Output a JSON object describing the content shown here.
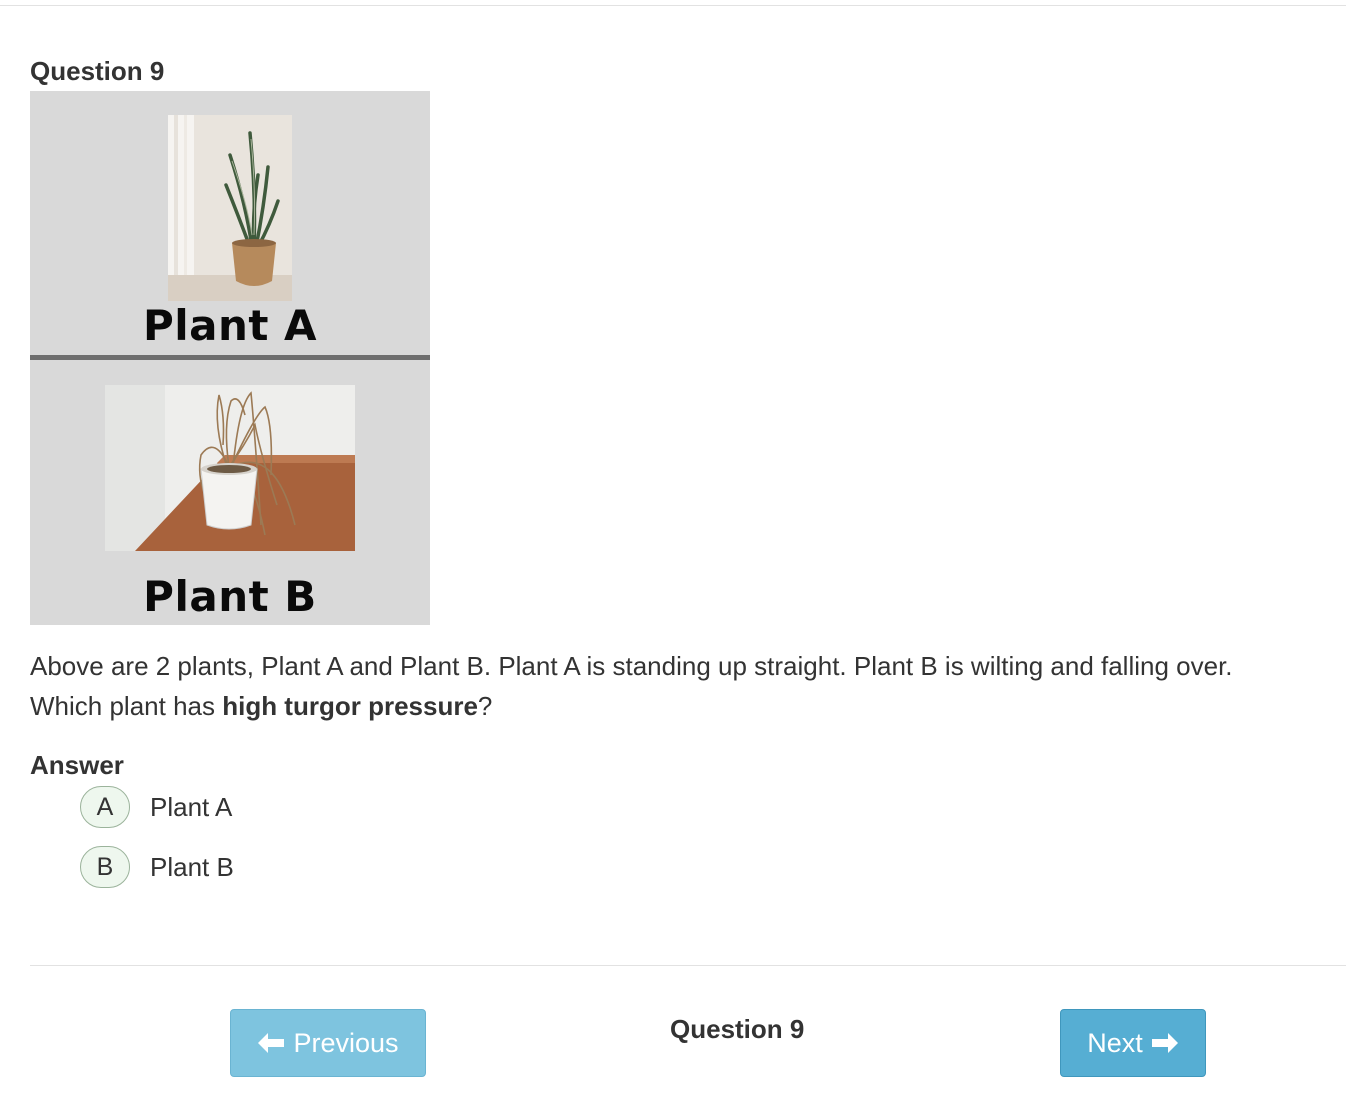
{
  "question": {
    "title": "Question 9",
    "figure": {
      "plant_a_label": "Plant A",
      "plant_b_label": "Plant B"
    },
    "prompt_line1": "Above are 2 plants, Plant A and Plant B. Plant A is standing up straight. Plant B is wilting and falling over.",
    "prompt_line2_before": "Which plant has ",
    "prompt_line2_bold": "high turgor pressure",
    "prompt_line2_after": "?"
  },
  "answer": {
    "heading": "Answer",
    "options": [
      {
        "letter": "A",
        "text": "Plant A"
      },
      {
        "letter": "B",
        "text": "Plant B"
      }
    ]
  },
  "navigation": {
    "previous_label": "Previous",
    "next_label": "Next",
    "current": "Question 9",
    "previous_icon": "arrow-left-icon",
    "next_icon": "arrow-right-icon"
  },
  "colors": {
    "button_prev": "#7ec4df",
    "button_next": "#56aed3",
    "option_bg": "#eef7ee",
    "figure_bg": "#d9d9d9"
  }
}
